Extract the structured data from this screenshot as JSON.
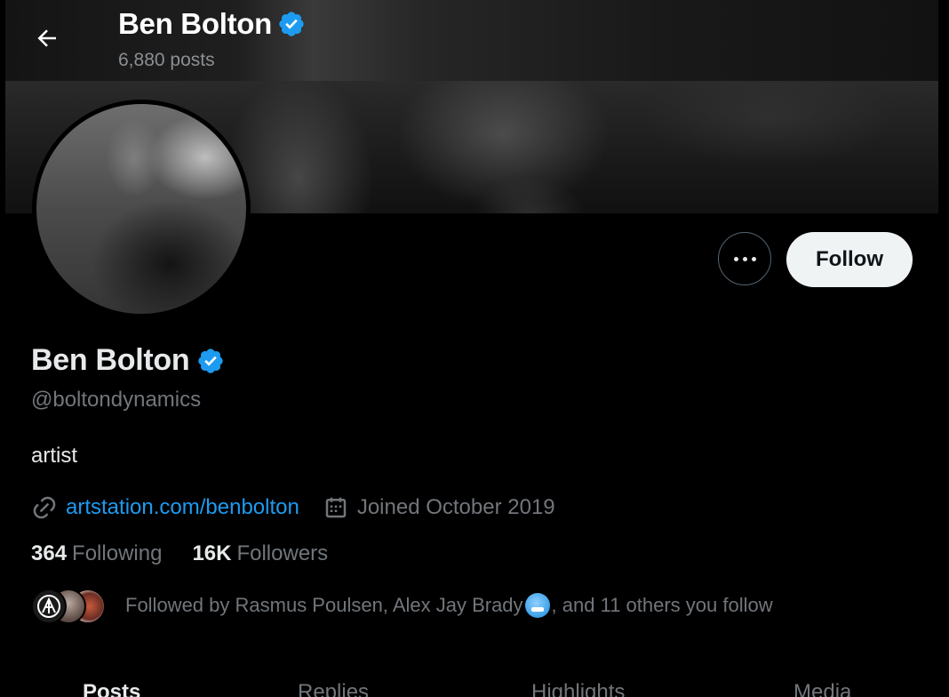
{
  "header": {
    "name": "Ben Bolton",
    "posts_count": "6,880 posts"
  },
  "profile": {
    "name": "Ben Bolton",
    "handle": "@boltondynamics",
    "bio": "artist",
    "website": "artstation.com/benbolton",
    "joined": "Joined October 2019",
    "following_count": "364",
    "following_label": "Following",
    "followers_count": "16K",
    "followers_label": "Followers",
    "followed_by_pre": "Followed by Rasmus Poulsen, Alex Jay Brady",
    "followed_by_post": ", and 11 others you follow"
  },
  "actions": {
    "follow_label": "Follow"
  },
  "tabs": [
    {
      "label": "Posts",
      "active": true
    },
    {
      "label": "Replies",
      "active": false
    },
    {
      "label": "Highlights",
      "active": false
    },
    {
      "label": "Media",
      "active": false
    }
  ],
  "colors": {
    "background": "#000000",
    "accent": "#1d9bf0",
    "muted_text": "#71767b",
    "verified": "#1d9bf0",
    "follow_button_bg": "#eff3f4"
  },
  "icons": {
    "back": "arrow-left-icon",
    "verified": "verified-badge-icon",
    "more": "more-dots-icon",
    "link": "link-icon",
    "calendar": "calendar-icon"
  }
}
